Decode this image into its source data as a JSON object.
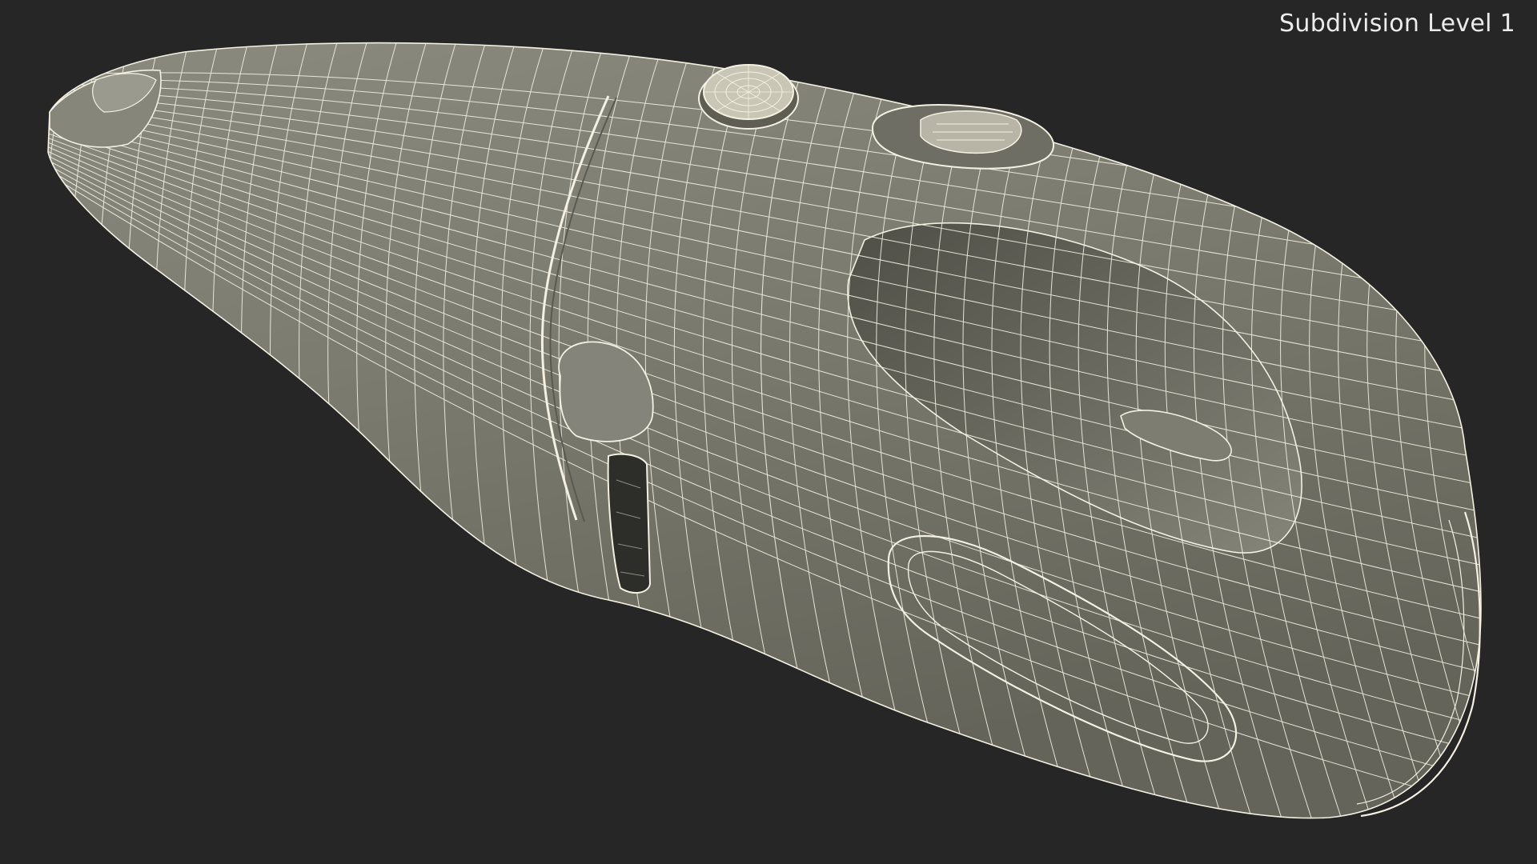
{
  "viewport": {
    "label": "Subdivision Level 1"
  },
  "render": {
    "object_icon": "handheld-vacuum-wireframe",
    "background_color": "#262626",
    "surface_color": "#7a7a6e",
    "surface_shadow_color": "#5c5c52",
    "surface_highlight_color": "#8e8e82",
    "wire_color": "#f4f1e3"
  }
}
